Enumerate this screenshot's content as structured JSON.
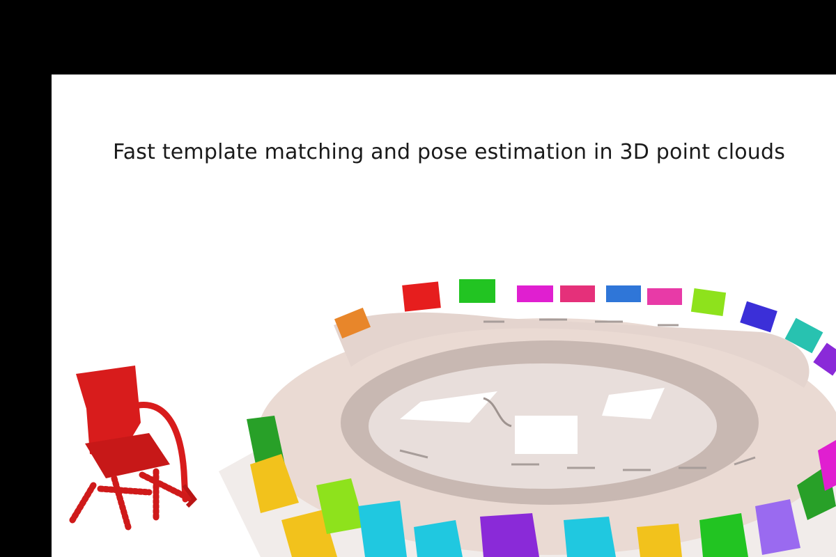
{
  "slide": {
    "title": "Fast template matching and pose estimation in 3D point clouds"
  },
  "figure": {
    "template_label": "template-chair",
    "scene_label": "conference-room-point-cloud",
    "colors": {
      "background": "#000000",
      "canvas": "#ffffff",
      "table": "#eadad3",
      "template_chair": "#d81c1c",
      "chairs": [
        "#e61e1e",
        "#22c422",
        "#e01fd0",
        "#e5307a",
        "#2f76d8",
        "#e83aa7",
        "#8ee21c",
        "#3b2fd8",
        "#28c2b0",
        "#8a2ad8",
        "#e8862a",
        "#f2c21c",
        "#20c8e0",
        "#28a028",
        "#9a6af0"
      ]
    }
  }
}
